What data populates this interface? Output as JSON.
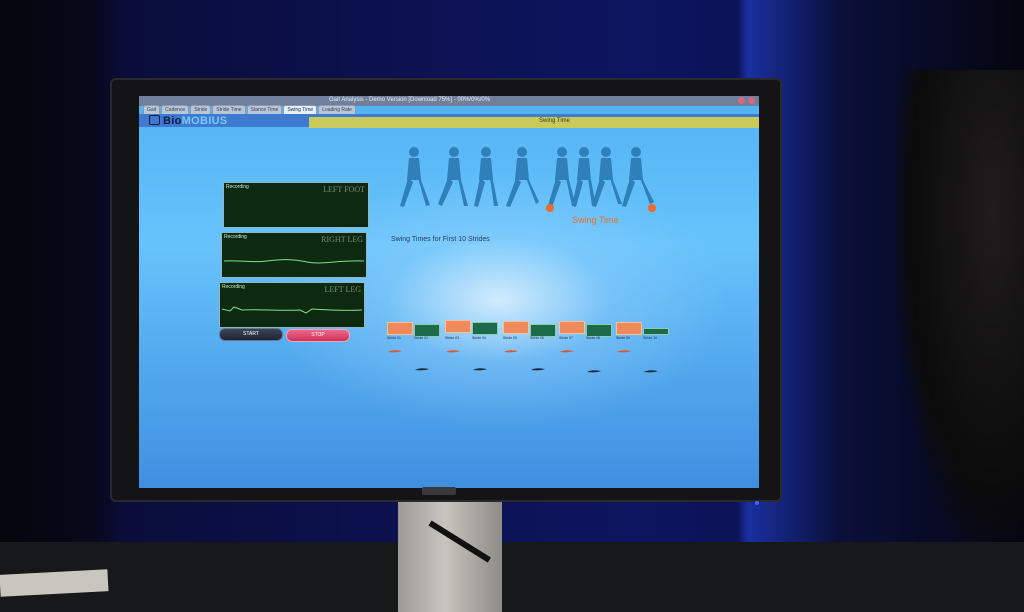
{
  "window": {
    "title": "Gait Analysis - Demo Version [Download 75%] - 00%/0%/0%",
    "tabs": [
      "Gait",
      "Cadence",
      "Stride",
      "Stride Time",
      "Stance Time",
      "Swing Time",
      "Loading Rate"
    ],
    "active_tab": "Swing Time"
  },
  "brand": {
    "part1": "Bio",
    "part2": "MOBIUS"
  },
  "header": {
    "section_title": "Swing Time"
  },
  "graphs": [
    {
      "label": "Recording",
      "name": "LEFT FOOT"
    },
    {
      "label": "Recording",
      "name": "RIGHT LEG"
    },
    {
      "label": "Recording",
      "name": "LEFT LEG"
    }
  ],
  "controls": {
    "start": "START",
    "stop": "STOP"
  },
  "figure": {
    "swing_label": "Swing Time"
  },
  "swing_times_title": "Swing Times for First 10 Strides",
  "strides": [
    {
      "label_a": "Stride 01",
      "label_b": "Stride 02"
    },
    {
      "label_a": "Stride 03",
      "label_b": "Stride 04"
    },
    {
      "label_a": "Stride 05",
      "label_b": "Stride 06"
    },
    {
      "label_a": "Stride 07",
      "label_b": "Stride 08"
    },
    {
      "label_a": "Stride 09",
      "label_b": "Stride 10"
    }
  ],
  "colors": {
    "screen_bg": "#5fbaf8",
    "stop_button": "#e04a72",
    "orange_box": "#f08a5a",
    "green_box": "#1d6b4a",
    "accent_orange": "#f06a2a"
  }
}
